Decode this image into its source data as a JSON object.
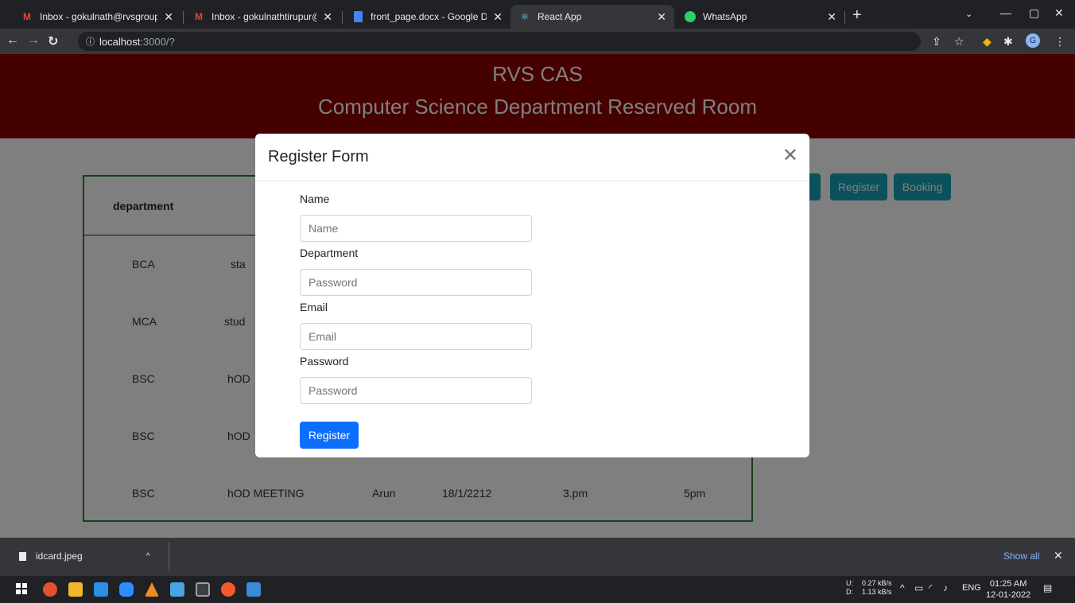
{
  "browser": {
    "tabs": [
      {
        "title": "Inbox - gokulnath@rvsgroup.com",
        "icon": "gmail-icon",
        "active": false
      },
      {
        "title": "Inbox - gokulnathtirupur@gmail.",
        "icon": "gmail-icon",
        "active": false
      },
      {
        "title": "front_page.docx - Google Docs",
        "icon": "docs-icon",
        "active": false
      },
      {
        "title": "React App",
        "icon": "react-icon",
        "active": true
      },
      {
        "title": "WhatsApp",
        "icon": "whatsapp-icon",
        "active": false
      }
    ],
    "url_host": "localhost",
    "url_path": ":3000/?"
  },
  "page": {
    "header_line1": "RVS CAS",
    "header_line2": "Computer Science Department Reserved Room",
    "nav_buttons": [
      "Register",
      "Booking"
    ],
    "table": {
      "header_first": "department",
      "rows": [
        [
          "BCA",
          "sta"
        ],
        [
          "MCA",
          "stud"
        ],
        [
          "BSC",
          "hOD"
        ],
        [
          "BSC",
          "hOD"
        ],
        [
          "BSC",
          "hOD MEETING",
          "Arun",
          "18/1/2212",
          "3.pm",
          "5pm"
        ]
      ]
    }
  },
  "modal": {
    "title": "Register Form",
    "fields": [
      {
        "label": "Name",
        "placeholder": "Name"
      },
      {
        "label": "Department",
        "placeholder": "Password"
      },
      {
        "label": "Email",
        "placeholder": "Email"
      },
      {
        "label": "Password",
        "placeholder": "Password"
      }
    ],
    "submit": "Register"
  },
  "downloads": {
    "file": "idcard.jpeg",
    "show_all": "Show all"
  },
  "taskbar": {
    "net_up_label": "U:",
    "net_down_label": "D:",
    "net_up": "0.27 kB/s",
    "net_down": "1.13 kB/s",
    "lang": "ENG",
    "time": "01:25 AM",
    "date": "12-01-2022"
  },
  "colors": {
    "header_bg": "#8b0000",
    "info_button": "#17a2b8",
    "primary_button": "#0d6efd",
    "table_border": "#2e7d32"
  }
}
